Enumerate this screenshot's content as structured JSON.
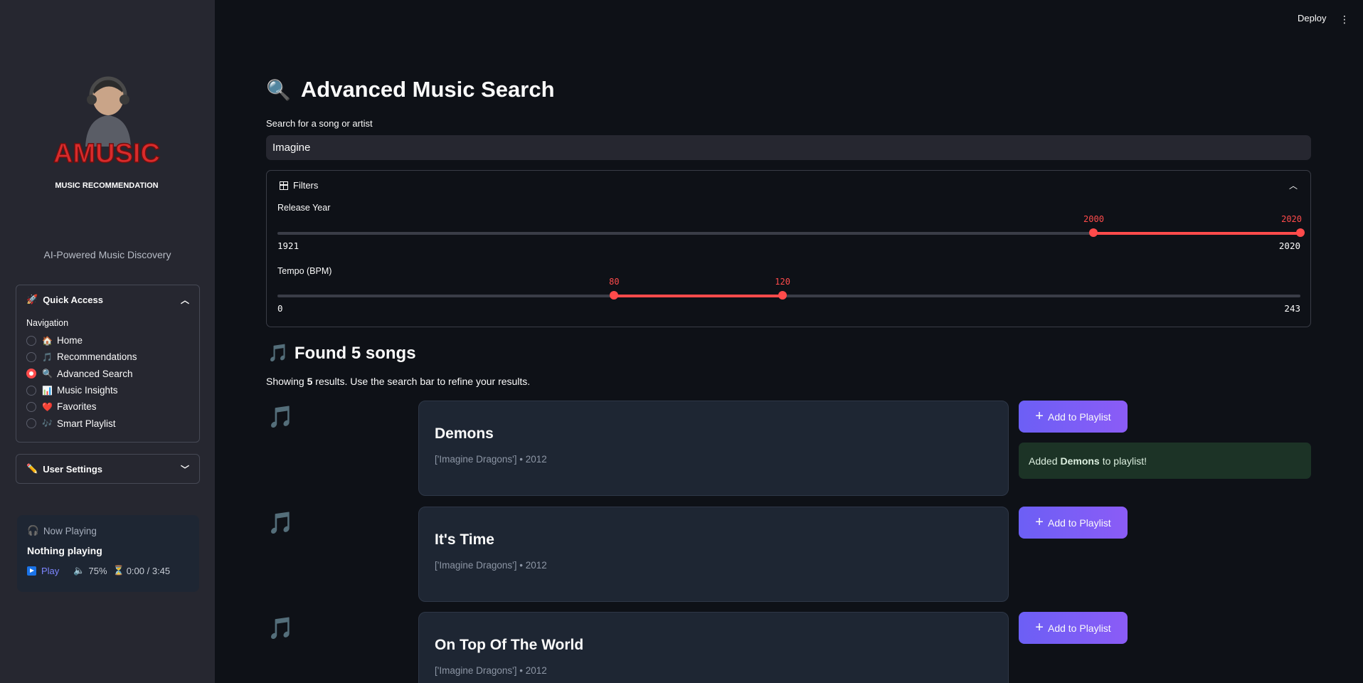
{
  "header": {
    "deploy_label": "Deploy",
    "menu_icon": "kebab-menu-icon"
  },
  "sidebar": {
    "logo_text": "AMUSIC",
    "logo_subtext": "MUSIC RECOMMENDATION",
    "tagline": "AI-Powered Music Discovery",
    "quick_access": {
      "title": "Quick Access",
      "icon": "rocket-icon",
      "nav_label": "Navigation",
      "items": [
        {
          "label": "Home",
          "emoji": "🏠",
          "selected": false
        },
        {
          "label": "Recommendations",
          "emoji": "🎵",
          "selected": false
        },
        {
          "label": "Advanced Search",
          "emoji": "🔍",
          "selected": true
        },
        {
          "label": "Music Insights",
          "emoji": "📊",
          "selected": false
        },
        {
          "label": "Favorites",
          "emoji": "❤️",
          "selected": false
        },
        {
          "label": "Smart Playlist",
          "emoji": "🎶",
          "selected": false
        }
      ]
    },
    "user_settings": {
      "title": "User Settings",
      "icon": "pencil-icon"
    },
    "now_playing": {
      "title": "Now Playing",
      "status": "Nothing playing",
      "play_label": "Play",
      "volume": "75%",
      "time": "0:00 / 3:45"
    }
  },
  "main": {
    "title": "Advanced Music Search",
    "search": {
      "label": "Search for a song or artist",
      "value": "Imagine"
    },
    "filters": {
      "title": "Filters",
      "release_year": {
        "label": "Release Year",
        "min": 1921,
        "max": 2020,
        "low": 2000,
        "high": 2020
      },
      "tempo": {
        "label": "Tempo (BPM)",
        "min": 0,
        "max": 243,
        "low": 80,
        "high": 120
      }
    },
    "results_heading": "Found 5 songs",
    "showing_prefix": "Showing ",
    "showing_count": "5",
    "showing_suffix": " results. Use the search bar to refine your results.",
    "add_button_label": "Add to Playlist",
    "toast": {
      "prefix": "Added",
      "song": "Demons",
      "suffix": "to playlist!"
    },
    "songs": [
      {
        "title": "Demons",
        "meta": "['Imagine Dragons'] • 2012"
      },
      {
        "title": "It's Time",
        "meta": "['Imagine Dragons'] • 2012"
      },
      {
        "title": "On Top Of The World",
        "meta": "['Imagine Dragons'] • 2012"
      }
    ]
  }
}
